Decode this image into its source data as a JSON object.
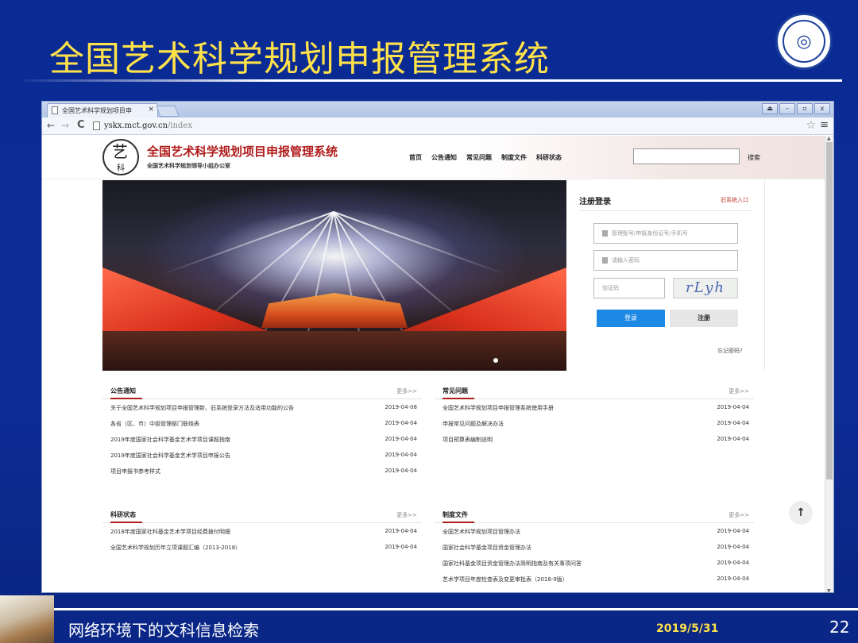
{
  "slide": {
    "title": "全国艺术科学规划申报管理系统",
    "footer_text": "网络环境下的文科信息检索",
    "footer_date": "2019/5/31",
    "page_number": "22",
    "colors": {
      "background": "#0c2c96",
      "title": "#ffe24a"
    }
  },
  "browser": {
    "tab_title": "全国艺术科学规划项目申",
    "close_glyph": "×",
    "url_host": "yskx.mct.gov.cn",
    "url_path": "/index",
    "back_glyph": "←",
    "forward_glyph": "→",
    "reload_glyph": "C",
    "star_glyph": "☆",
    "menu_glyph": "≡",
    "window_buttons": [
      "⏏",
      "–",
      "▫",
      "x"
    ]
  },
  "site": {
    "logo_char_top": "艺",
    "logo_char_bottom": "科",
    "name": "全国艺术科学规划项目申报管理系统",
    "subtitle": "全国艺术科学规划领导小组办公室",
    "nav": [
      "首页",
      "公告通知",
      "常见问题",
      "制度文件",
      "科研状态"
    ],
    "search_button": "搜索",
    "accent_color": "#b01b1b"
  },
  "login": {
    "title": "注册登录",
    "old_system_link": "旧系统入口",
    "username_placeholder": "管理账号/申报身份证号/手机号",
    "password_placeholder": "请输入密码",
    "captcha_placeholder": "验证码",
    "captcha_text": "rLyh",
    "login_button": "登录",
    "register_button": "注册",
    "forgot_link": "忘记密码?",
    "login_button_color": "#1e88e5"
  },
  "sections": {
    "notices": {
      "title": "公告通知",
      "more": "更多>>",
      "items": [
        {
          "title": "关于全国艺术科学规划项目申报管理新、旧系统登录方法及适用功能的公告",
          "date": "2019-04-08"
        },
        {
          "title": "各省（区、市）中级管理部门联络表",
          "date": "2019-04-04"
        },
        {
          "title": "2019年度国家社会科学基金艺术学项目课题指南",
          "date": "2019-04-04"
        },
        {
          "title": "2019年度国家社会科学基金艺术学项目申报公告",
          "date": "2019-04-04"
        },
        {
          "title": "项目申报书参考样式",
          "date": "2019-04-04"
        }
      ]
    },
    "faq": {
      "title": "常见问题",
      "more": "更多>>",
      "items": [
        {
          "title": "全国艺术科学规划项目申报管理系统使用手册",
          "date": "2019-04-04"
        },
        {
          "title": "申报常见问题及解决办法",
          "date": "2019-04-04"
        },
        {
          "title": "项目预算表编制说明",
          "date": "2019-04-04"
        }
      ]
    },
    "research": {
      "title": "科研状态",
      "more": "更多>>",
      "items": [
        {
          "title": "2018年度国家社科基金艺术学项目经费拨付明细",
          "date": "2019-04-04"
        },
        {
          "title": "全国艺术科学规划历年立项课题汇编（2013-2018）",
          "date": "2019-04-04"
        }
      ]
    },
    "regulations": {
      "title": "制度文件",
      "more": "更多>>",
      "items": [
        {
          "title": "全国艺术科学规划项目管理办法",
          "date": "2019-04-04"
        },
        {
          "title": "国家社会科学基金项目资金管理办法",
          "date": "2019-04-04"
        },
        {
          "title": "国家社科基金项目资金管理办法简明指南及有关事项问答",
          "date": "2019-04-04"
        },
        {
          "title": "艺术学项目年度检查表及变更审批表（2018-9版）",
          "date": "2019-04-04"
        }
      ]
    }
  },
  "to_top_glyph": "↑"
}
